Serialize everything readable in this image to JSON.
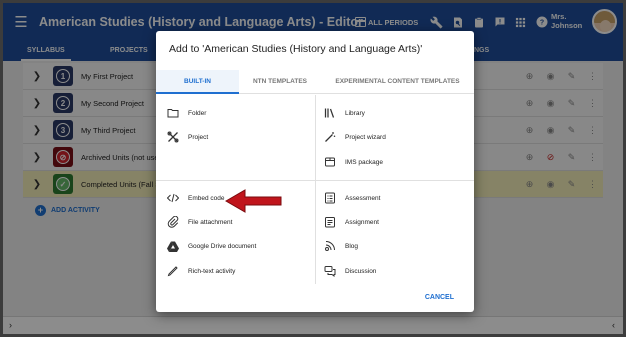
{
  "app": {
    "title": "American Studies (History and Language Arts) - Editor",
    "periods_label": "ALL PERIODS",
    "user_name_line1": "Mrs.",
    "user_name_line2": "Johnson"
  },
  "tabs": [
    {
      "label": "SYLLABUS"
    },
    {
      "label": "PROJECTS"
    },
    {
      "label": "NGS"
    }
  ],
  "rows": [
    {
      "badge": "1",
      "label": "My First Project"
    },
    {
      "badge": "2",
      "label": "My Second Project"
    },
    {
      "badge": "3",
      "label": "My Third Project"
    },
    {
      "badge": "⊘",
      "label": "Archived Units (not used"
    },
    {
      "badge": "✓",
      "label": "Completed Units (Fall Se"
    }
  ],
  "add_activity_label": "ADD ACTIVITY",
  "dialog": {
    "title": "Add to 'American Studies (History and Language Arts)'",
    "tabs": [
      "BUILT-IN",
      "NTN TEMPLATES",
      "EXPERIMENTAL CONTENT TEMPLATES"
    ],
    "left_top": [
      {
        "icon": "folder-icon",
        "label": "Folder"
      },
      {
        "icon": "project-icon",
        "label": "Project"
      }
    ],
    "right_top": [
      {
        "icon": "library-icon",
        "label": "Library"
      },
      {
        "icon": "wand-icon",
        "label": "Project wizard"
      },
      {
        "icon": "package-icon",
        "label": "IMS package"
      }
    ],
    "left_bottom": [
      {
        "icon": "code-icon",
        "label": "Embed code"
      },
      {
        "icon": "paperclip-icon",
        "label": "File attachment"
      },
      {
        "icon": "google-drive-icon",
        "label": "Google Drive document"
      },
      {
        "icon": "pencil-icon",
        "label": "Rich-text activity"
      }
    ],
    "right_bottom": [
      {
        "icon": "assessment-icon",
        "label": "Assessment"
      },
      {
        "icon": "assignment-icon",
        "label": "Assignment"
      },
      {
        "icon": "blog-icon",
        "label": "Blog"
      },
      {
        "icon": "discussion-icon",
        "label": "Discussion"
      }
    ],
    "cancel_label": "CANCEL"
  },
  "colors": {
    "primary": "#1f4e9b",
    "accent": "#1f6fd0",
    "highlight_row": "#f5eebb",
    "arrow": "#c0151c"
  }
}
